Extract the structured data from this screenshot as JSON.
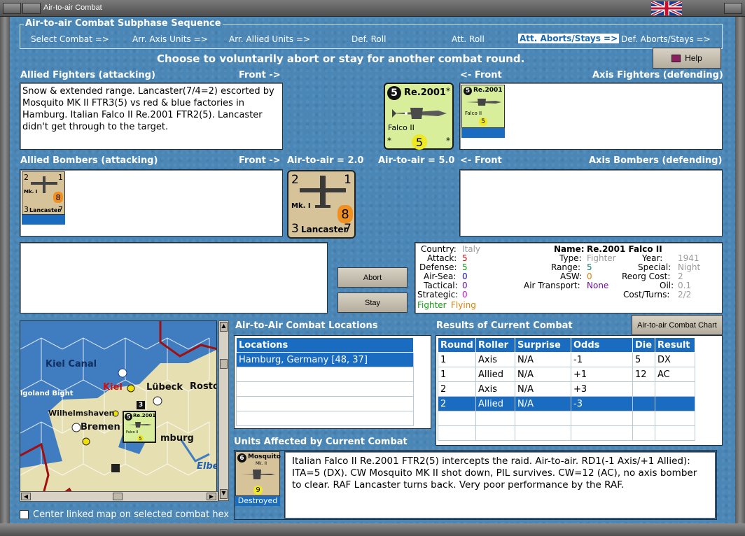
{
  "window": {
    "title": "Air-to-air Combat"
  },
  "sequence": {
    "title": "Air-to-air Combat Subphase Sequence",
    "steps": [
      "Select Combat =>",
      "Arr. Axis Units =>",
      "Arr. Allied Units =>",
      "Def. Roll",
      "Att. Roll",
      "Att. Aborts/Stays =>",
      "Def. Aborts/Stays =>"
    ],
    "active_index": 5
  },
  "instruction": "Choose to voluntarily abort or stay for another combat round.",
  "help_button": "Help",
  "allied_fighters": {
    "header": "Allied Fighters (attacking)",
    "front": "Front ->"
  },
  "axis_fighters": {
    "header": "Axis Fighters (defending)",
    "front": "<- Front"
  },
  "allied_bombers": {
    "header": "Allied Bombers (attacking)",
    "front": "Front ->"
  },
  "axis_bombers": {
    "header": "Axis Bombers (defending)",
    "front": "<- Front"
  },
  "air_to_air_left": "Air-to-air = 2.0",
  "air_to_air_right": "Air-to-air = 5.0",
  "notes": "Snow & extended range.  Lancaster(7/4=2) escorted by Mosquito MK II FTR3(5) vs red & blue factories in Hamburg.  Italian Falco II Re.2001 FTR2(5).  Lancaster didn't get through to the target.",
  "falco_counter": {
    "top_num": "5",
    "name": "Re.2001",
    "subname": "Falco II",
    "bottom_num": "5",
    "star": "*"
  },
  "lancaster_counter": {
    "tl": "2",
    "tr": "1",
    "mk": "Mk. I",
    "val": "8",
    "bl": "3",
    "name": "Lancaster",
    "br": "7"
  },
  "mosquito_counter": {
    "top_num": "6",
    "name": "Mosquito",
    "mk": "Mk. II",
    "val": "9",
    "status": "Destroyed"
  },
  "buttons": {
    "abort": "Abort",
    "stay": "Stay",
    "chart": "Air-to-air Combat Chart"
  },
  "unit_info": {
    "country_label": "Country:",
    "country": "Italy",
    "attack_label": "Attack:",
    "attack": "5",
    "defense_label": "Defense:",
    "defense": "5",
    "airsea_label": "Air-Sea:",
    "airsea": "0",
    "tactical_label": "Tactical:",
    "tactical": "0",
    "strategic_label": "Strategic:",
    "strategic": "0",
    "class_a": "Fighter",
    "class_b": "Flying",
    "name_label": "Name:",
    "name": "Re.2001 Falco II",
    "type_label": "Type:",
    "type": "Fighter",
    "range_label": "Range:",
    "range": "5",
    "asw_label": "ASW:",
    "asw": "0",
    "transport_label": "Air Transport:",
    "transport": "None",
    "year_label": "Year:",
    "year": "1941",
    "special_label": "Special:",
    "special": "Night",
    "reorg_label": "Reorg Cost:",
    "reorg": "2",
    "oil_label": "Oil:",
    "oil": "0.1",
    "cost_label": "Cost/Turns:",
    "cost": "2/2"
  },
  "map": {
    "labels": {
      "kiel_canal": "Kiel Canal",
      "kiel": "Kiel",
      "lubeck": "Lübeck",
      "rostock": "Rosto",
      "heligoland": "lgoland Bight",
      "wilhelmshaven": "Wilhelmshaven",
      "bremen": "Bremen",
      "hamburg": "mburg",
      "elbe": "Elbe"
    },
    "stack_count": "3",
    "center_checkbox": "Center linked map on selected combat hex"
  },
  "locations": {
    "title": "Air-to-Air Combat Locations",
    "column": "Locations",
    "rows": [
      "Hamburg, Germany [48, 37]"
    ]
  },
  "results": {
    "title": "Results of Current Combat",
    "columns": [
      "Round",
      "Roller",
      "Surprise",
      "Odds",
      "Die",
      "Result"
    ],
    "rows": [
      [
        "1",
        "Axis",
        "N/A",
        "-1",
        "5",
        "DX"
      ],
      [
        "1",
        "Allied",
        "N/A",
        "+1",
        "12",
        "AC"
      ],
      [
        "2",
        "Axis",
        "N/A",
        "+3",
        "",
        ""
      ],
      [
        "2",
        "Allied",
        "N/A",
        "-3",
        "",
        ""
      ]
    ],
    "selected_row": 3
  },
  "affected": {
    "title": "Units Affected by Current Combat",
    "text": "Italian Falco II Re.2001 FTR2(5) intercepts the raid.  Air-to-air.  RD1(-1 Axis/+1 Allied):  ITA=5 (DX).  CW Mosquito MK II shot down, PIL survives.  CW=12 (AC), no axis bomber to clear.  RAF Lancaster turns back.  Very poor performance by the RAF."
  }
}
